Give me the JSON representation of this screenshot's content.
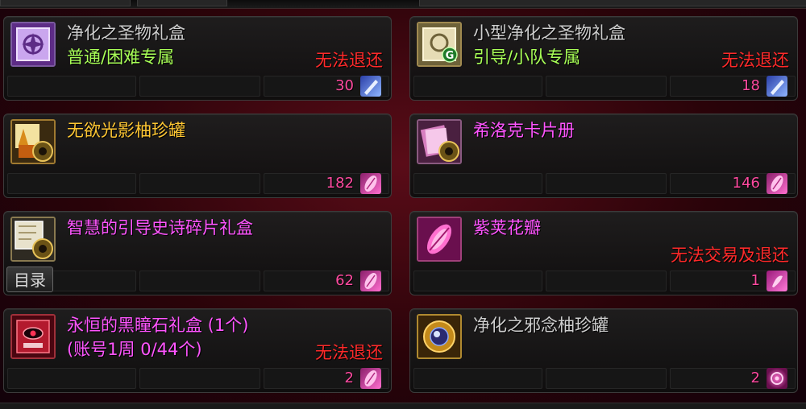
{
  "colors": {
    "name_gray": "#cfcfcf",
    "name_gold": "#ffc733",
    "name_magenta": "#ff55ff",
    "sub_green": "#a8ff57",
    "warn_red": "#ff2a2a",
    "count_pink": "#ff4aa0"
  },
  "ui": {
    "catalog_label": "目录"
  },
  "items": [
    {
      "name": "净化之圣物礼盒",
      "name_color": "#cfcfcf",
      "sub": "普通/困难专属",
      "sub_color": "#a8ff57",
      "warning": "无法退还",
      "count": "30",
      "currency_icon": "crystal-shard-icon",
      "icon": "purple-relic-box-icon"
    },
    {
      "name": "小型净化之圣物礼盒",
      "name_color": "#cfcfcf",
      "sub": "引导/小队专属",
      "sub_color": "#a8ff57",
      "warning": "无法退还",
      "count": "18",
      "currency_icon": "crystal-shard-icon",
      "icon": "small-relic-box-icon"
    },
    {
      "name": "无欲光影柚珍罐",
      "name_color": "#ffc733",
      "sub": "",
      "sub_color": "#a8ff57",
      "warning": "",
      "count": "182",
      "currency_icon": "pink-petal-icon",
      "icon": "light-shadow-jar-icon"
    },
    {
      "name": "希洛克卡片册",
      "name_color": "#ff55ff",
      "sub": "",
      "sub_color": "#a8ff57",
      "warning": "",
      "count": "146",
      "currency_icon": "pink-petal-icon",
      "icon": "card-album-icon"
    },
    {
      "name": "智慧的引导史诗碎片礼盒",
      "name_color": "#ff55ff",
      "sub": "",
      "sub_color": "#a8ff57",
      "warning": "",
      "count": "62",
      "currency_icon": "pink-petal-icon",
      "icon": "epic-fragment-box-icon"
    },
    {
      "name": "紫荚花瓣",
      "name_color": "#ff55ff",
      "sub": "",
      "sub_color": "#a8ff57",
      "warning": "无法交易及退还",
      "count": "1",
      "currency_icon": "pink-token-icon",
      "icon": "purple-petal-icon"
    },
    {
      "name": "永恒的黑瞳石礼盒 (1个)",
      "name_color": "#ff55ff",
      "sub": "(账号1周 0/44个)",
      "sub_color": "#ff55ff",
      "warning": "无法退还",
      "count": "2",
      "currency_icon": "pink-petal-icon",
      "icon": "black-pupil-stone-box-icon"
    },
    {
      "name": "净化之邪念柚珍罐",
      "name_color": "#cfcfcf",
      "sub": "",
      "sub_color": "#a8ff57",
      "warning": "",
      "count": "2",
      "currency_icon": "dark-orb-icon",
      "icon": "evil-thought-jar-icon"
    }
  ]
}
